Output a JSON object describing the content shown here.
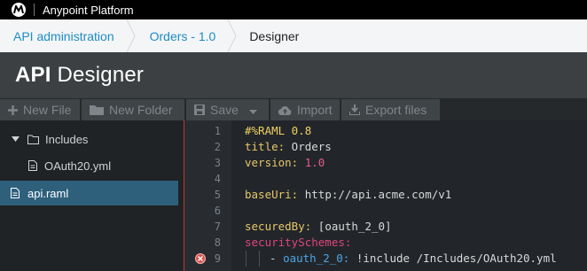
{
  "topbar": {
    "product": "Anypoint Platform"
  },
  "breadcrumb": {
    "items": [
      "API administration",
      "Orders - 1.0",
      "Designer"
    ]
  },
  "header": {
    "title_bold": "API",
    "title_rest": " Designer"
  },
  "toolbar": {
    "new_file": "New File",
    "new_folder": "New Folder",
    "save": "Save",
    "import": "Import",
    "export": "Export files"
  },
  "sidebar": {
    "folder": "Includes",
    "folder_file": "OAuth20.yml",
    "root_file": "api.raml"
  },
  "editor": {
    "line_numbers": [
      "1",
      "2",
      "3",
      "4",
      "5",
      "6",
      "7",
      "8",
      "9"
    ],
    "l1": "#%RAML 0.8",
    "l2_key": "title:",
    "l2_val": " Orders",
    "l3_key": "version:",
    "l3_val": "1.0",
    "l5_key": "baseUri:",
    "l5_val": " http://api.acme.com/v1",
    "l7_key": "securedBy:",
    "l7_val": " [oauth_2_0]",
    "l8_key": "securitySchemes:",
    "l9_dash": "- ",
    "l9_key": "oauth_2_0:",
    "l9_val": " !include /Includes/OAuth20.yml"
  },
  "colors": {
    "accent": "#1c8cc4",
    "selected": "#2e607c",
    "error": "#d9534f"
  }
}
